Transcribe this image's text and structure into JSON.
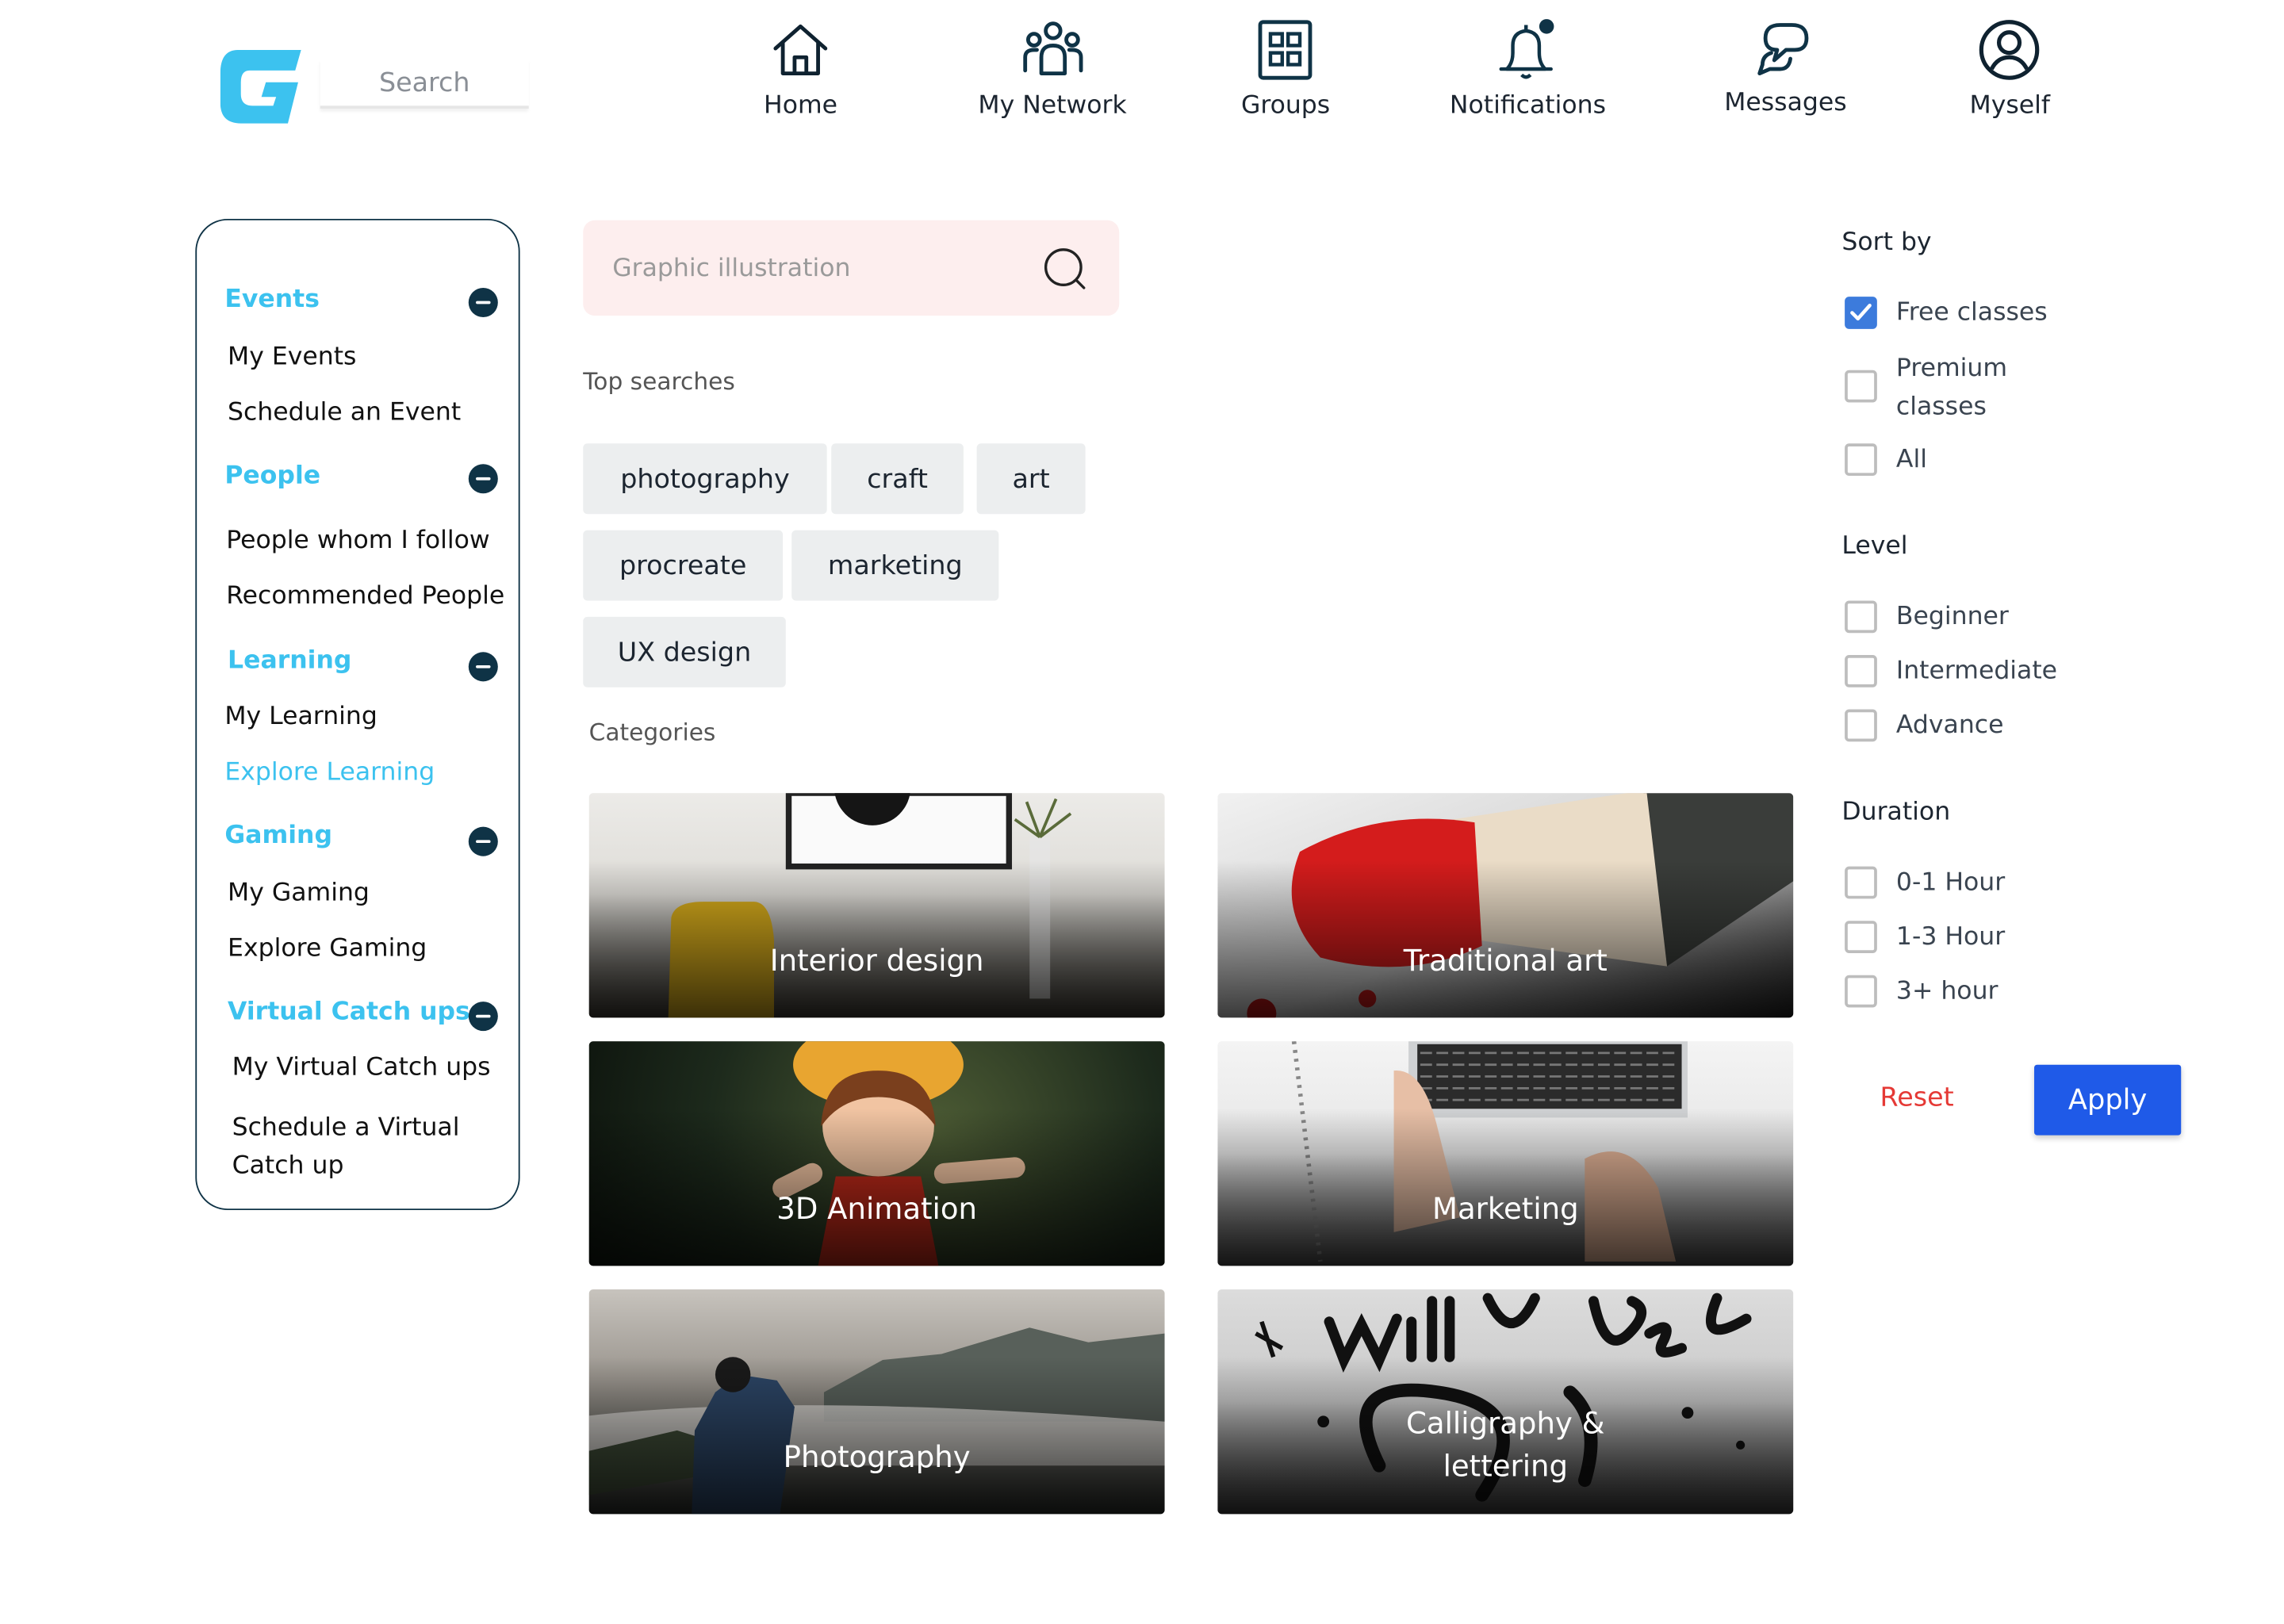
{
  "header": {
    "search_placeholder": "Search",
    "nav": [
      {
        "label": "Home",
        "icon": "home-icon"
      },
      {
        "label": "My Network",
        "icon": "network-icon"
      },
      {
        "label": "Groups",
        "icon": "groups-icon"
      },
      {
        "label": "Notifications",
        "icon": "bell-icon"
      },
      {
        "label": "Messages",
        "icon": "chat-icon"
      },
      {
        "label": "Myself",
        "icon": "user-circle-icon"
      }
    ]
  },
  "sidebar": {
    "sections": [
      {
        "title": "Events",
        "items": [
          "My Events",
          "Schedule an Event"
        ]
      },
      {
        "title": "People",
        "items": [
          "People whom I follow",
          "Recommended People"
        ]
      },
      {
        "title": "Learning",
        "items": [
          "My Learning",
          "Explore Learning"
        ]
      },
      {
        "title": "Gaming",
        "items": [
          "My Gaming",
          "Explore Gaming"
        ]
      },
      {
        "title": "Virtual Catch ups",
        "items": [
          "My Virtual Catch ups",
          "Schedule a Virtual Catch up"
        ]
      }
    ],
    "active_item": "Explore Learning"
  },
  "main": {
    "search_placeholder": "Graphic illustration",
    "top_searches_label": "Top searches",
    "top_searches": [
      "photography",
      "craft",
      "art",
      "procreate",
      "marketing",
      "UX design"
    ],
    "categories_label": "Categories",
    "categories": [
      "Interior design",
      "Traditional art",
      "3D Animation",
      "Marketing",
      "Photography",
      "Calligraphy & lettering"
    ]
  },
  "filters": {
    "sort_by": {
      "title": "Sort by",
      "options": [
        {
          "label": "Free classes",
          "checked": true
        },
        {
          "label": "Premium classes",
          "checked": false
        },
        {
          "label": "All",
          "checked": false
        }
      ]
    },
    "level": {
      "title": "Level",
      "options": [
        {
          "label": "Beginner",
          "checked": false
        },
        {
          "label": "Intermediate",
          "checked": false
        },
        {
          "label": "Advance",
          "checked": false
        }
      ]
    },
    "duration": {
      "title": "Duration",
      "options": [
        {
          "label": "0-1 Hour",
          "checked": false
        },
        {
          "label": "1-3 Hour",
          "checked": false
        },
        {
          "label": "3+ hour",
          "checked": false
        }
      ]
    },
    "reset_label": "Reset",
    "apply_label": "Apply"
  },
  "colors": {
    "accent": "#3cc2ef",
    "navy": "#0f3346",
    "apply": "#1f5ae8",
    "reset": "#e53935",
    "checkbox": "#3c7bdc"
  }
}
